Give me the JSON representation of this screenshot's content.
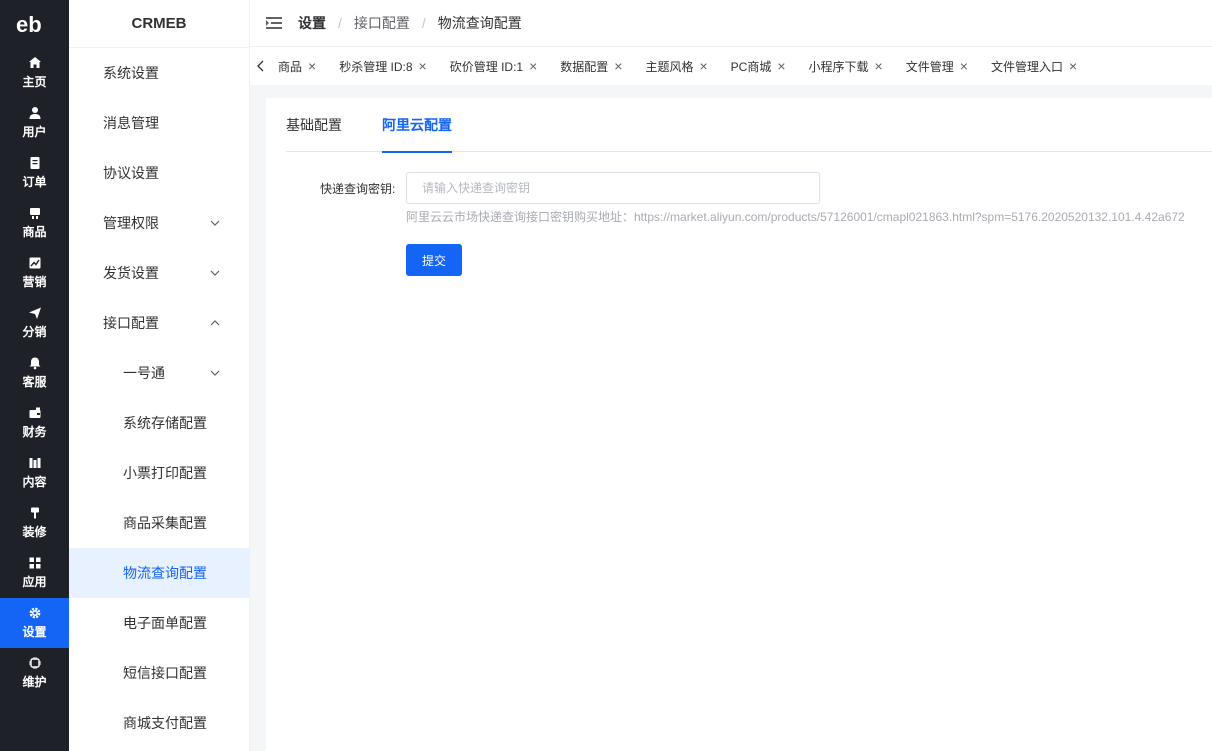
{
  "rail": {
    "logo": "eb",
    "items": [
      {
        "label": "主页",
        "icon": "home-icon"
      },
      {
        "label": "用户",
        "icon": "user-icon"
      },
      {
        "label": "订单",
        "icon": "order-icon"
      },
      {
        "label": "商品",
        "icon": "product-icon"
      },
      {
        "label": "营销",
        "icon": "marketing-icon"
      },
      {
        "label": "分销",
        "icon": "distribution-icon"
      },
      {
        "label": "客服",
        "icon": "bell-icon"
      },
      {
        "label": "财务",
        "icon": "wallet-icon"
      },
      {
        "label": "内容",
        "icon": "content-icon"
      },
      {
        "label": "装修",
        "icon": "brush-icon"
      },
      {
        "label": "应用",
        "icon": "apps-icon"
      },
      {
        "label": "设置",
        "icon": "gear-icon",
        "active": true
      },
      {
        "label": "维护",
        "icon": "chip-icon"
      }
    ],
    "accent": "#1464f5",
    "background": "#1e2127"
  },
  "submenu": {
    "brand": "CRMEB",
    "items": [
      {
        "label": "系统设置"
      },
      {
        "label": "消息管理"
      },
      {
        "label": "协议设置"
      },
      {
        "label": "管理权限",
        "chevron": "down"
      },
      {
        "label": "发货设置",
        "chevron": "down"
      },
      {
        "label": "接口配置",
        "chevron": "up"
      },
      {
        "label": "一号通",
        "chevron": "down",
        "child": true
      },
      {
        "label": "系统存储配置",
        "child": true
      },
      {
        "label": "小票打印配置",
        "child": true
      },
      {
        "label": "商品采集配置",
        "child": true
      },
      {
        "label": "物流查询配置",
        "child": true,
        "active": true
      },
      {
        "label": "电子面单配置",
        "child": true
      },
      {
        "label": "短信接口配置",
        "child": true
      },
      {
        "label": "商城支付配置",
        "child": true
      }
    ]
  },
  "header": {
    "breadcrumb": [
      "设置",
      "接口配置",
      "物流查询配置"
    ],
    "separator": "/"
  },
  "tags": [
    {
      "label": "商品"
    },
    {
      "label": "秒杀管理 ID:8"
    },
    {
      "label": "砍价管理 ID:1"
    },
    {
      "label": "数据配置"
    },
    {
      "label": "主题风格"
    },
    {
      "label": "PC商城"
    },
    {
      "label": "小程序下载"
    },
    {
      "label": "文件管理"
    },
    {
      "label": "文件管理入口"
    }
  ],
  "tag_close": "×",
  "tabs": [
    {
      "label": "基础配置"
    },
    {
      "label": "阿里云配置",
      "active": true
    }
  ],
  "form": {
    "label": "快递查询密钥:",
    "placeholder": "请输入快递查询密钥",
    "value": "",
    "hint": "阿里云云市场快递查询接口密钥购买地址：https://market.aliyun.com/products/57126001/cmapl021863.html?spm=5176.2020520132.101.4.42a672",
    "submit_label": "提交"
  }
}
